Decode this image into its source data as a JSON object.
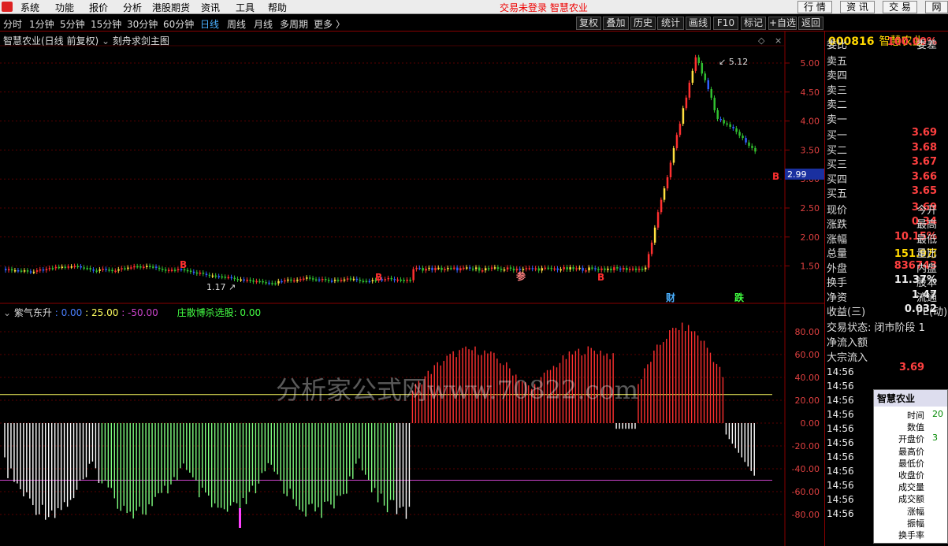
{
  "menubar": {
    "items": [
      "系统",
      "功能",
      "报价",
      "分析",
      "港股期货",
      "资讯",
      "工具",
      "帮助"
    ],
    "status": "交易未登录",
    "stock": "智慧农业",
    "buttons": [
      "行 情",
      "资 讯",
      "交 易",
      "网"
    ]
  },
  "periods": {
    "items": [
      "分时",
      "1分钟",
      "5分钟",
      "15分钟",
      "30分钟",
      "60分钟",
      "日线",
      "周线",
      "月线",
      "多周期",
      "更多 〉"
    ],
    "active": "日线"
  },
  "toolbar": {
    "buttons": [
      "复权",
      "叠加",
      "历史",
      "统计",
      "画线",
      "F10",
      "标记",
      "+自选",
      "返回"
    ]
  },
  "main_chart": {
    "title": "智慧农业(日线 前复权)",
    "indicator": "刻舟求剑主图",
    "high_label": "5.12",
    "low_label": "1.17",
    "last_price": "2.99"
  },
  "chart_data": [
    {
      "type": "candlestick",
      "name": "main",
      "ylim": [
        1.2,
        5.3
      ],
      "yticks": [
        "5.00",
        "4.50",
        "4.00",
        "3.50",
        "3.00",
        "2.50",
        "2.00",
        "1.50"
      ],
      "annotations": [
        "B",
        "B",
        "B",
        "B",
        "参",
        "财",
        "跌"
      ]
    },
    {
      "type": "bar",
      "name": "紫气东升",
      "ylim": [
        -100,
        100
      ],
      "yticks": [
        "80.00",
        "60.00",
        "40.00",
        "20.00",
        "0.00",
        "-20.00",
        "-40.00",
        "-60.00",
        "-80.00"
      ],
      "reference_lines": [
        {
          "value": 25,
          "color": "#ffff60"
        },
        {
          "value": -50,
          "color": "#cc44cc"
        }
      ]
    }
  ],
  "indicator_panel": {
    "name": "紫气东升",
    "v1": ": 0.00",
    "v2": ": 25.00",
    "v3": ": -50.00",
    "extra": "庄散博杀选股: 0.00"
  },
  "watermark": "分析家公式网www.70822.com",
  "quote": {
    "code": "000816",
    "name": "智慧农业",
    "header": [
      {
        "l": "委比",
        "v": "100.00%",
        "x": "委差"
      }
    ],
    "asks": [
      "卖五",
      "卖四",
      "卖三",
      "卖二",
      "卖一"
    ],
    "bids": [
      {
        "l": "买一",
        "v": "3.69"
      },
      {
        "l": "买二",
        "v": "3.68"
      },
      {
        "l": "买三",
        "v": "3.67"
      },
      {
        "l": "买四",
        "v": "3.66"
      },
      {
        "l": "买五",
        "v": "3.65"
      }
    ],
    "stats": [
      {
        "l": "现价",
        "v": "3.69",
        "x": "今开"
      },
      {
        "l": "涨跌",
        "v": "0.34",
        "x": "最高"
      },
      {
        "l": "涨幅",
        "v": "10.15%",
        "x": "最低"
      },
      {
        "l": "总量",
        "v": "151.9万",
        "x": "量比"
      },
      {
        "l": "外盘",
        "v": "836743",
        "x": "内盘"
      },
      {
        "l": "换手",
        "v": "11.37%",
        "x": "股本"
      },
      {
        "l": "净资",
        "v": "1.47",
        "x": "流通"
      },
      {
        "l": "收益(三)",
        "v": "0.032",
        "x": "PE(动)"
      }
    ],
    "trade_state": "交易状态: 闭市阶段 1",
    "flow1": "净流入额",
    "flow2": "大宗流入",
    "ticks": [
      "14:56",
      "14:56",
      "14:56",
      "14:56",
      "14:56",
      "14:56",
      "14:56",
      "14:56",
      "14:56",
      "14:56",
      "14:56"
    ],
    "tick_first": "3.69"
  },
  "popup": {
    "title": "智慧农业",
    "labels": [
      "时间",
      "数值",
      "开盘价",
      "最高价",
      "最低价",
      "收盘价",
      "成交量",
      "成交额",
      "涨幅",
      "振幅",
      "换手率"
    ],
    "vals": [
      "20",
      "",
      "3"
    ]
  }
}
